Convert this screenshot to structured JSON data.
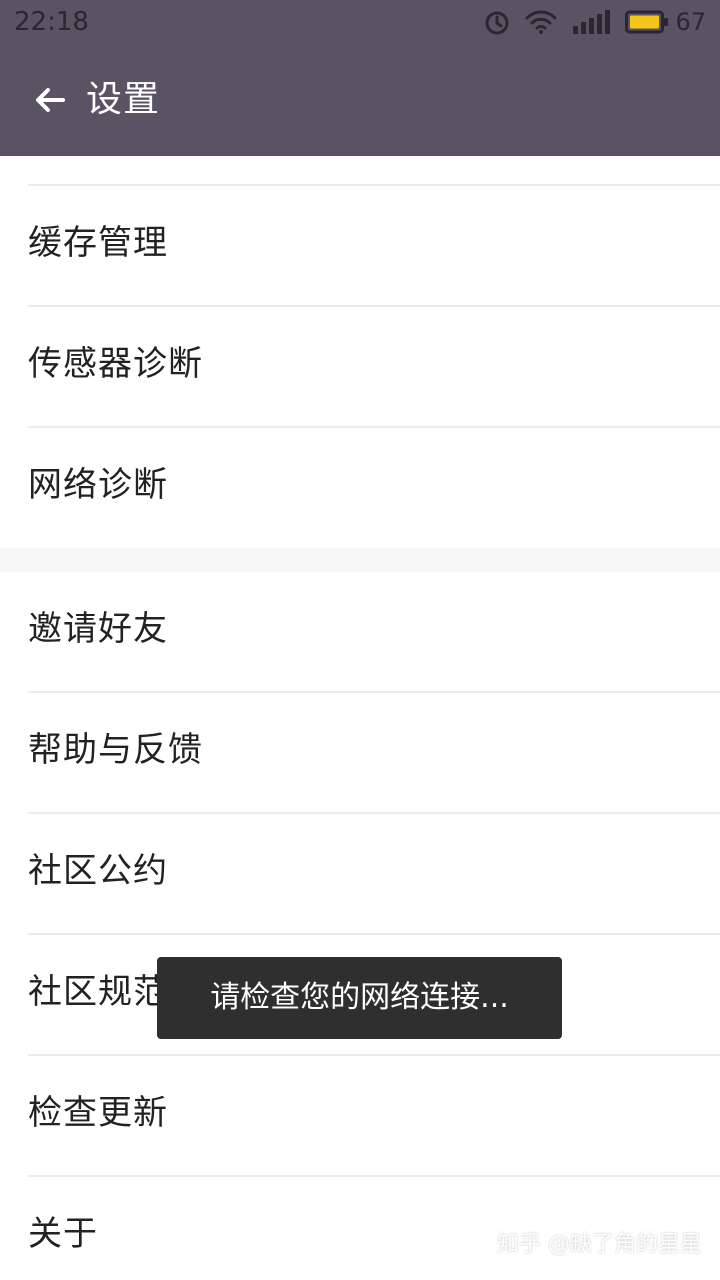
{
  "status_bar": {
    "time": "22:18",
    "icons": [
      "alarm-icon",
      "wifi-icon",
      "signal-icon",
      "battery-icon"
    ],
    "battery_level": "67"
  },
  "app_bar": {
    "title": "设置"
  },
  "colors": {
    "app_bar_bg": "#5a5363",
    "toast_bg": "#2f2f2f",
    "battery_fill": "#f5c518"
  },
  "settings": {
    "group1": [
      {
        "label": "缓存管理"
      },
      {
        "label": "传感器诊断"
      },
      {
        "label": "网络诊断"
      }
    ],
    "group2": [
      {
        "label": "邀请好友"
      },
      {
        "label": "帮助与反馈"
      },
      {
        "label": "社区公约"
      },
      {
        "label": "社区规范"
      },
      {
        "label": "检查更新"
      },
      {
        "label": "关于"
      }
    ]
  },
  "toast": {
    "message": "请检查您的网络连接..."
  },
  "watermark": "知乎 @缺了角的星星"
}
